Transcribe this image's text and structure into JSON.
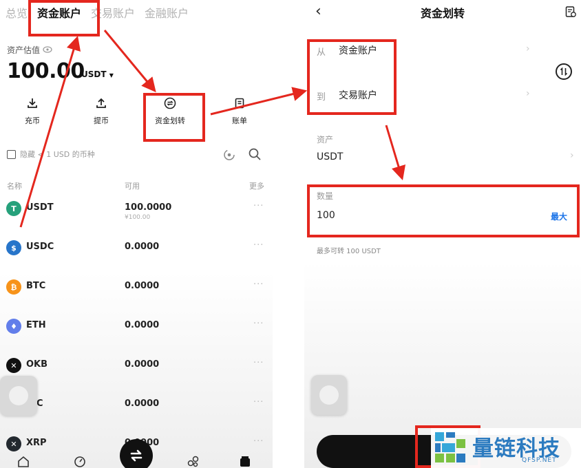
{
  "left_screen": {
    "tabs": [
      {
        "label": "总览"
      },
      {
        "label": "资金账户",
        "active": true
      },
      {
        "label": "交易账户"
      },
      {
        "label": "金融账户"
      }
    ],
    "asset_estimate_label": "资产估值",
    "balance": "100.00",
    "balance_unit": "USDT",
    "actions": [
      {
        "label": "充币",
        "icon": "deposit-icon"
      },
      {
        "label": "提币",
        "icon": "withdraw-icon"
      },
      {
        "label": "资金划转",
        "icon": "transfer-icon"
      },
      {
        "label": "账单",
        "icon": "bill-icon"
      }
    ],
    "hide_small_label": "隐藏 < 1 USD 的币种",
    "columns": {
      "name": "名称",
      "available": "可用",
      "more": "更多"
    },
    "assets": [
      {
        "symbol": "USDT",
        "amount": "100.0000",
        "sub": "¥100.00",
        "color": "#26a17b",
        "glyph": "T"
      },
      {
        "symbol": "USDC",
        "amount": "0.0000",
        "sub": "",
        "color": "#2775ca",
        "glyph": "$"
      },
      {
        "symbol": "BTC",
        "amount": "0.0000",
        "sub": "",
        "color": "#f7931a",
        "glyph": "₿"
      },
      {
        "symbol": "ETH",
        "amount": "0.0000",
        "sub": "",
        "color": "#627eea",
        "glyph": "♦"
      },
      {
        "symbol": "OKB",
        "amount": "0.0000",
        "sub": "",
        "color": "#111111",
        "glyph": "✕"
      },
      {
        "symbol": "LTC",
        "amount": "0.0000",
        "sub": "",
        "color": "#345d9d",
        "glyph": "Ł"
      },
      {
        "symbol": "XRP",
        "amount": "0.0000",
        "sub": "",
        "color": "#23292f",
        "glyph": "✕"
      }
    ],
    "more_glyph": "···"
  },
  "right_screen": {
    "title": "资金划转",
    "from_label": "从",
    "from_value": "资金账户",
    "to_label": "到",
    "to_value": "交易账户",
    "asset_label": "资产",
    "asset_value": "USDT",
    "amount_label": "数量",
    "amount_value": "100",
    "max_label": "最大",
    "available_text": "最多可转 100 USDT"
  },
  "watermark": {
    "name": "量链科技",
    "domain": "QFSP.NET"
  },
  "colors": {
    "annotation": "#e4271e",
    "accent": "#1a73e8",
    "watermark": "#2c7bc0"
  }
}
